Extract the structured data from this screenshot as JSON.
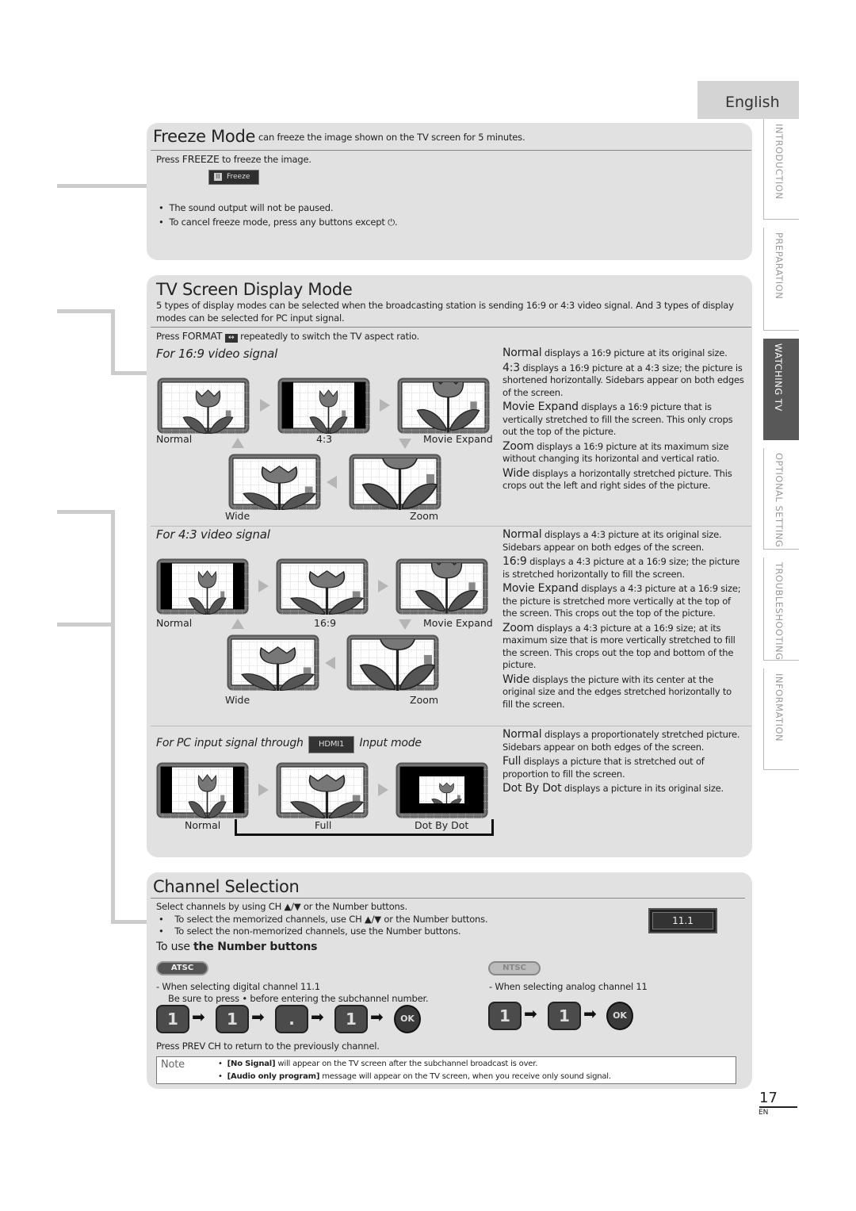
{
  "language_tab": "English",
  "side_tabs": [
    "INTRODUCTION",
    "PREPARATION",
    "WATCHING TV",
    "OPTIONAL SETTING",
    "TROUBLESHOOTING",
    "INFORMATION"
  ],
  "freeze": {
    "title": "Freeze Mode",
    "subtitle": "can freeze the image shown on the TV screen for 5 minutes.",
    "press_pre": "Press ",
    "press_key": "FREEZE",
    "press_post": " to freeze the image.",
    "osd_label": "Freeze",
    "bullets": [
      "The sound output will not be paused.",
      "To cancel freeze mode, press any buttons except ⏻."
    ]
  },
  "display": {
    "title": "TV Screen Display Mode",
    "intro": "5 types of display modes can be selected when the broadcasting station is sending 16:9 or 4:3 video signal. And 3 types of display modes can be selected for PC input signal.",
    "press_pre": "Press ",
    "press_key": "FORMAT",
    "press_post": " repeatedly to switch the TV aspect ratio.",
    "sec169": {
      "heading": "For 16:9 video signal",
      "labels": [
        "Normal",
        "4:3",
        "Movie Expand",
        "Wide",
        "Zoom"
      ],
      "items": [
        {
          "term": "Normal",
          "text": " displays a 16:9 picture at its original size."
        },
        {
          "term": "4:3",
          "text": " displays a 16:9 picture at a 4:3 size; the picture is shortened horizontally. Sidebars appear on both edges of the screen."
        },
        {
          "term": "Movie Expand",
          "text": " displays a 16:9 picture that is vertically stretched to fill the screen. This only crops out the top of the picture."
        },
        {
          "term": "Zoom",
          "text": " displays a 16:9 picture at its maximum size without changing its horizontal and vertical ratio."
        },
        {
          "term": "Wide",
          "text": " displays a horizontally stretched picture. This crops out the left and right sides of the picture."
        }
      ]
    },
    "sec43": {
      "heading": "For 4:3 video signal",
      "labels": [
        "Normal",
        "16:9",
        "Movie Expand",
        "Wide",
        "Zoom"
      ],
      "items": [
        {
          "term": "Normal",
          "text": " displays a 4:3 picture at its original size. Sidebars appear on both edges of the screen."
        },
        {
          "term": "16:9",
          "text": " displays a 4:3 picture at a 16:9 size; the picture is stretched horizontally to fill the screen."
        },
        {
          "term": "Movie Expand",
          "text": " displays a 4:3 picture at a 16:9 size; the picture is stretched more vertically at the top of the screen. This crops out the top of the picture."
        },
        {
          "term": "Zoom",
          "text": " displays a 4:3 picture at a 16:9 size; at its maximum size that is more vertically stretched to fill the screen. This crops out the top and bottom of the picture."
        },
        {
          "term": "Wide",
          "text": " displays the picture with its center at the original size and the edges stretched horizontally to fill the screen."
        }
      ]
    },
    "secpc": {
      "heading_pre": "For PC input signal through",
      "hdmi": "HDMI1",
      "heading_post": "Input mode",
      "labels": [
        "Normal",
        "Full",
        "Dot By Dot"
      ],
      "items": [
        {
          "term": "Normal",
          "text": " displays a proportionately stretched picture. Sidebars appear on both edges of the screen."
        },
        {
          "term": "Full",
          "text": " displays a picture that is stretched out of proportion to fill the screen."
        },
        {
          "term": "Dot By Dot",
          "text": " displays a picture in its original size."
        }
      ]
    }
  },
  "channel": {
    "title": "Channel Selection",
    "line1": "Select channels by using CH ▲/▼ or the Number buttons.",
    "bullets": [
      "To select the memorized channels, use CH ▲/▼ or the Number buttons.",
      "To select the non-memorized channels, use the Number buttons."
    ],
    "osd": "11.1",
    "sub_pre": "To use ",
    "sub_bold": "the Number buttons",
    "atsc": {
      "badge": "ATSC",
      "line1": "-  When selecting digital channel 11.1",
      "line2": "Be sure to press • before entering the subchannel number.",
      "keys": [
        "1",
        "1",
        ".",
        "1"
      ],
      "ok": "OK"
    },
    "ntsc": {
      "badge": "NTSC",
      "line1": "-  When selecting analog channel 11",
      "keys": [
        "1",
        "1"
      ],
      "ok": "OK"
    },
    "prev": "Press PREV CH to return to the previously channel.",
    "note_label": "Note",
    "notes": [
      {
        "b": "[No Signal]",
        "t": " will appear on the TV screen after the subchannel broadcast is over."
      },
      {
        "b": "[Audio only program]",
        "t": " message will appear on the TV screen, when you receive only sound signal."
      }
    ]
  },
  "page_number": "17",
  "page_lang": "EN"
}
